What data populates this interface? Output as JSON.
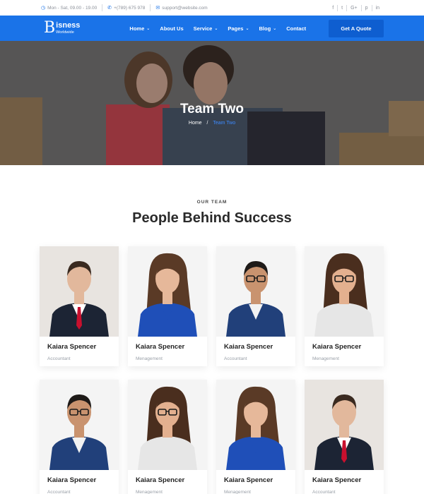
{
  "topbar": {
    "hours": "Mon - Sat, 09.00 - 19.00",
    "phone": "+(789) 675 978",
    "email": "support@website.com",
    "social": [
      "f",
      "t",
      "G+",
      "p",
      "in"
    ]
  },
  "nav": {
    "logo_letter": "B",
    "logo_main": "isness",
    "logo_sub": "Worldwide",
    "items": [
      {
        "label": "Home",
        "dropdown": true
      },
      {
        "label": "About Us",
        "dropdown": false
      },
      {
        "label": "Service",
        "dropdown": true
      },
      {
        "label": "Pages",
        "dropdown": true
      },
      {
        "label": "Blog",
        "dropdown": true
      },
      {
        "label": "Contact",
        "dropdown": false
      }
    ],
    "cta": "Get A Quote"
  },
  "hero": {
    "title": "Team Two",
    "crumb_home": "Home",
    "crumb_sep": "/",
    "crumb_current": "Team Two"
  },
  "section": {
    "eyebrow": "OUR TEAM",
    "heading": "People Behind Success"
  },
  "team": [
    {
      "name": "Kaiara Spencer",
      "role": "Accountant",
      "photo": "man-red-tie"
    },
    {
      "name": "Kaiara Spencer",
      "role": "Menagement",
      "photo": "woman-blue-thinking"
    },
    {
      "name": "Kaiara Spencer",
      "role": "Accountant",
      "photo": "man-glasses-blue-suit"
    },
    {
      "name": "Kaiara Spencer",
      "role": "Menagement",
      "photo": "woman-glasses-pointing"
    },
    {
      "name": "Kaiara Spencer",
      "role": "Accountant",
      "photo": "man-glasses-blue-suit"
    },
    {
      "name": "Kaiara Spencer",
      "role": "Menagement",
      "photo": "woman-glasses-pointing"
    },
    {
      "name": "Kaiara Spencer",
      "role": "Menagement",
      "photo": "woman-blue-thinking"
    },
    {
      "name": "Kaiara Spencer",
      "role": "Accountant",
      "photo": "man-red-tie"
    }
  ],
  "colors": {
    "primary": "#1a73e8",
    "cta": "#0e5ed0",
    "crumb_current": "#3d8bff"
  }
}
